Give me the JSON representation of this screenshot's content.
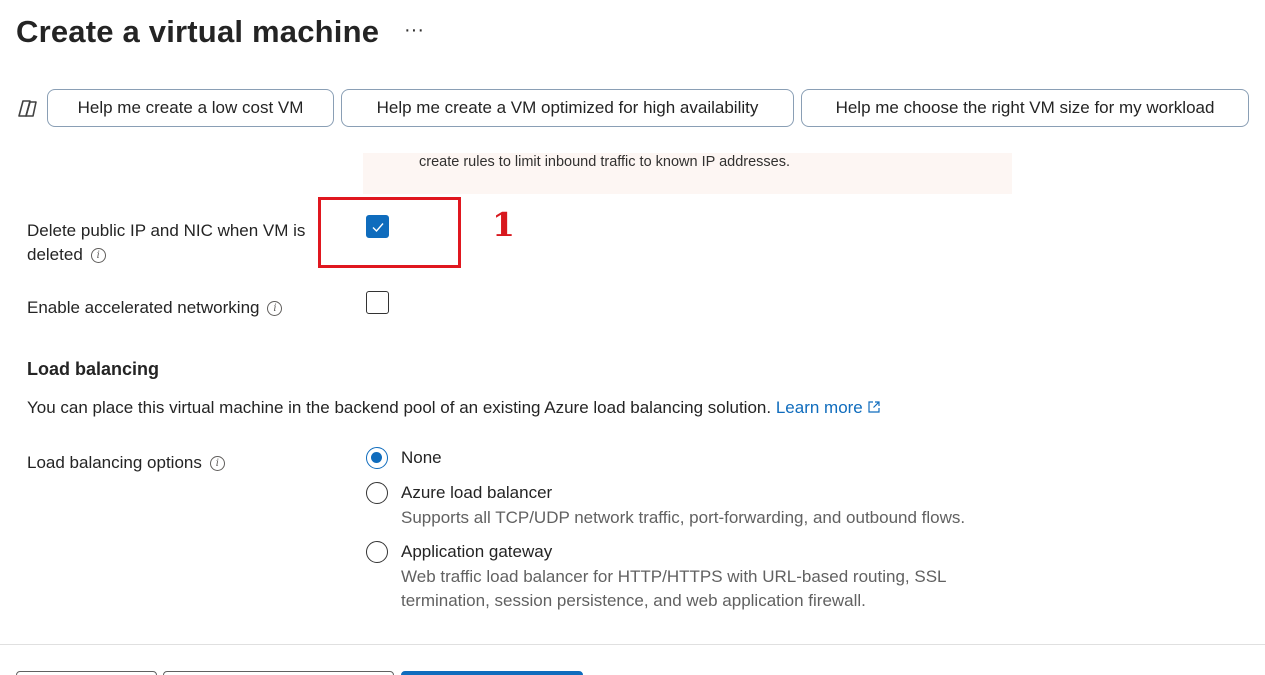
{
  "header": {
    "title": "Create a virtual machine",
    "more_label": "···"
  },
  "copilot": {
    "icon": "copilot-icon",
    "suggestions": [
      "Help me create a low cost VM",
      "Help me create a VM optimized for high availability",
      "Help me choose the right VM size for my workload"
    ]
  },
  "warning": {
    "text": "create rules to limit inbound traffic to known IP addresses."
  },
  "networking": {
    "delete_public_ip": {
      "label": "Delete public IP and NIC when VM is deleted",
      "checked": true
    },
    "accelerated_networking": {
      "label": "Enable accelerated networking",
      "checked": false
    }
  },
  "annotation": {
    "number": "1",
    "color": "#e0171f"
  },
  "load_balancing": {
    "title": "Load balancing",
    "description": "You can place this virtual machine in the backend pool of an existing Azure load balancing solution.",
    "learn_more": "Learn more",
    "options_label": "Load balancing options",
    "options": [
      {
        "label": "None",
        "description": "",
        "selected": true
      },
      {
        "label": "Azure load balancer",
        "description": "Supports all TCP/UDP network traffic, port-forwarding, and outbound flows.",
        "selected": false
      },
      {
        "label": "Application gateway",
        "description": "Web traffic load balancer for HTTP/HTTPS with URL-based routing, SSL termination, session persistence, and web application firewall.",
        "selected": false
      }
    ]
  },
  "colors": {
    "accent": "#0f6cbd",
    "warning_bg": "#fdf6f3"
  }
}
